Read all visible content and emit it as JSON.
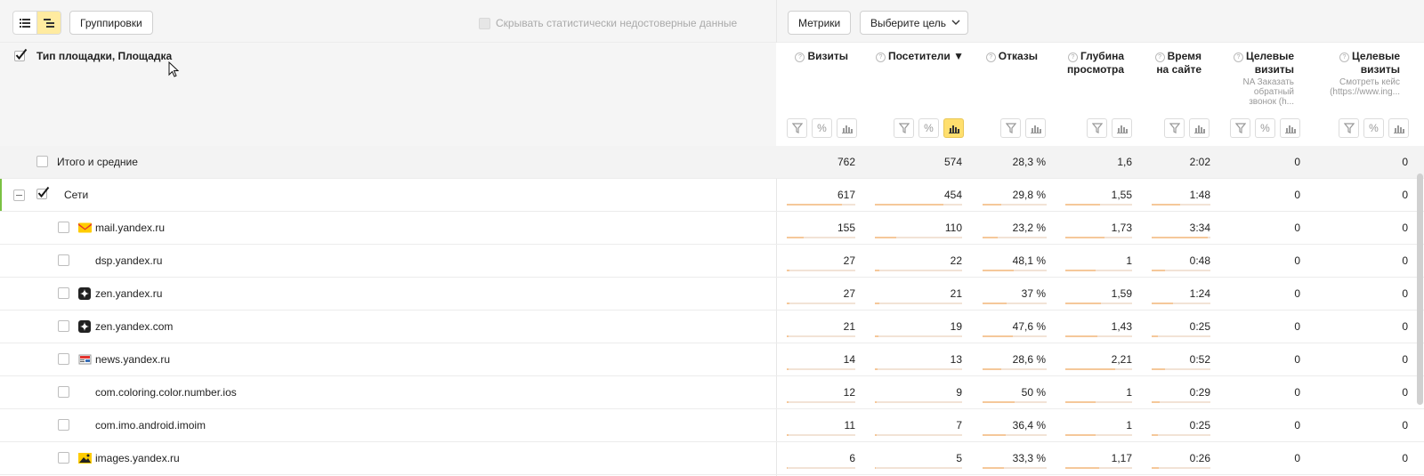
{
  "toolbar": {
    "groupings_label": "Группировки",
    "hide_unreliable_label": "Скрывать статистически недостоверные данные",
    "metrics_label": "Метрики",
    "goal_select_label": "Выберите цель"
  },
  "table": {
    "dimension_header": "Тип площадки, Площадка",
    "columns": [
      {
        "title_1": "Визиты",
        "title_2": "",
        "subtitle": ""
      },
      {
        "title_1": "Посетители ▼",
        "title_2": "",
        "subtitle": ""
      },
      {
        "title_1": "Отказы",
        "title_2": "",
        "subtitle": ""
      },
      {
        "title_1": "Глубина",
        "title_2": "просмотра",
        "subtitle": ""
      },
      {
        "title_1": "Время",
        "title_2": "на сайте",
        "subtitle": ""
      },
      {
        "title_1": "Целевые",
        "title_2": "визиты",
        "subtitle": "NA Заказать обратный звонок (h..."
      },
      {
        "title_1": "Целевые",
        "title_2": "визиты",
        "subtitle": "Смотреть кейс (https://www.ing..."
      }
    ],
    "rows": [
      {
        "label": "Итого и средние",
        "values": [
          "762",
          "574",
          "28,3 %",
          "1,6",
          "2:02",
          "0",
          "0"
        ],
        "bars": [],
        "icon": "",
        "level": 0
      },
      {
        "label": "Сети",
        "values": [
          "617",
          "454",
          "29,8 %",
          "1,55",
          "1:48",
          "0",
          "0"
        ],
        "bars": [
          0.81,
          0.79,
          0.298,
          0.52,
          0.48
        ],
        "icon": "",
        "level": 1
      },
      {
        "label": "mail.yandex.ru",
        "values": [
          "155",
          "110",
          "23,2 %",
          "1,73",
          "3:34",
          "0",
          "0"
        ],
        "bars": [
          0.25,
          0.24,
          0.232,
          0.58,
          0.95
        ],
        "icon": "mail-icon",
        "level": 2
      },
      {
        "label": "dsp.yandex.ru",
        "values": [
          "27",
          "22",
          "48,1 %",
          "1",
          "0:48",
          "0",
          "0"
        ],
        "bars": [
          0.04,
          0.05,
          0.481,
          0.45,
          0.22
        ],
        "icon": "",
        "level": 2
      },
      {
        "label": "zen.yandex.ru",
        "values": [
          "27",
          "21",
          "37 %",
          "1,59",
          "1:24",
          "0",
          "0"
        ],
        "bars": [
          0.04,
          0.05,
          0.37,
          0.53,
          0.37
        ],
        "icon": "zen-icon",
        "level": 2
      },
      {
        "label": "zen.yandex.com",
        "values": [
          "21",
          "19",
          "47,6 %",
          "1,43",
          "0:25",
          "0",
          "0"
        ],
        "bars": [
          0.03,
          0.04,
          0.476,
          0.48,
          0.11
        ],
        "icon": "zen-icon",
        "level": 2
      },
      {
        "label": "news.yandex.ru",
        "values": [
          "14",
          "13",
          "28,6 %",
          "2,21",
          "0:52",
          "0",
          "0"
        ],
        "bars": [
          0.02,
          0.03,
          0.286,
          0.74,
          0.23
        ],
        "icon": "news-icon",
        "level": 2
      },
      {
        "label": "com.coloring.color.number.ios",
        "values": [
          "12",
          "9",
          "50 %",
          "1",
          "0:29",
          "0",
          "0"
        ],
        "bars": [
          0.02,
          0.02,
          0.5,
          0.45,
          0.13
        ],
        "icon": "",
        "level": 2
      },
      {
        "label": "com.imo.android.imoim",
        "values": [
          "11",
          "7",
          "36,4 %",
          "1",
          "0:25",
          "0",
          "0"
        ],
        "bars": [
          0.02,
          0.02,
          0.364,
          0.45,
          0.11
        ],
        "icon": "",
        "level": 2
      },
      {
        "label": "images.yandex.ru",
        "values": [
          "6",
          "5",
          "33,3 %",
          "1,17",
          "0:26",
          "0",
          "0"
        ],
        "bars": [
          0.01,
          0.01,
          0.333,
          0.5,
          0.12
        ],
        "icon": "images-icon",
        "level": 2
      }
    ]
  },
  "colors": {
    "accent_yellow": "#ffdf6e",
    "bar_fill": "#f5c89a",
    "bar_track": "#f2e3d6",
    "group_marker": "#7ac143"
  }
}
